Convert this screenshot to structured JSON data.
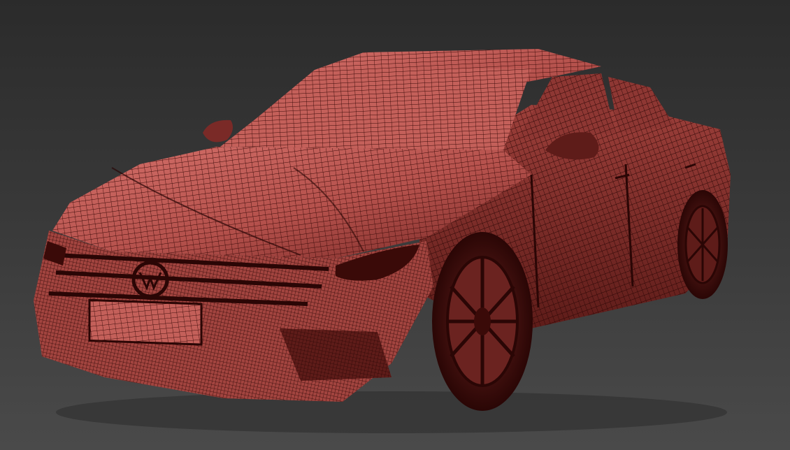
{
  "viewport": {
    "mode": "3d-perspective",
    "shading": "wireframe-on-shaded"
  },
  "colors": {
    "background_top": "#2b2b2b",
    "background_bottom": "#4a4a4a",
    "surface_base": "#b5514c",
    "surface_light": "#d4706a",
    "surface_shadow": "#7a2a27",
    "wire": "#3a0a08",
    "wire_dense": "#2a0605"
  },
  "model": {
    "object": "sedan-car",
    "view": "front-three-quarter-left"
  }
}
